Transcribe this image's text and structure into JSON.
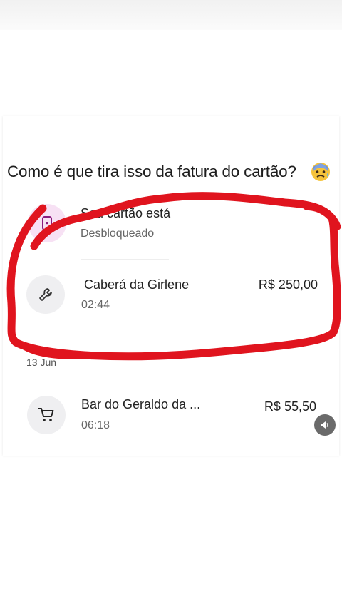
{
  "caption": "Como é que tira isso da fatura do cartão?",
  "caption_emoji": "anxious-face-with-sweat-emoji",
  "card_status": {
    "title": "Seu cartão está",
    "subtitle": "Desbloqueado",
    "icon": "card-icon"
  },
  "transactions": [
    {
      "title": "Caberá da Girlene",
      "time": "02:44",
      "amount": "R$ 250,00",
      "icon": "wrench-icon"
    },
    {
      "title": "Bar do Geraldo da ...",
      "time": "06:18",
      "amount": "R$ 55,50",
      "icon": "cart-icon"
    }
  ],
  "date_separator": "13 Jun",
  "colors": {
    "scribble": "#e0141e",
    "status_avatar_bg": "#f7e1f4",
    "status_icon": "#8a1a7e",
    "avatar_bg": "#efeff1"
  }
}
